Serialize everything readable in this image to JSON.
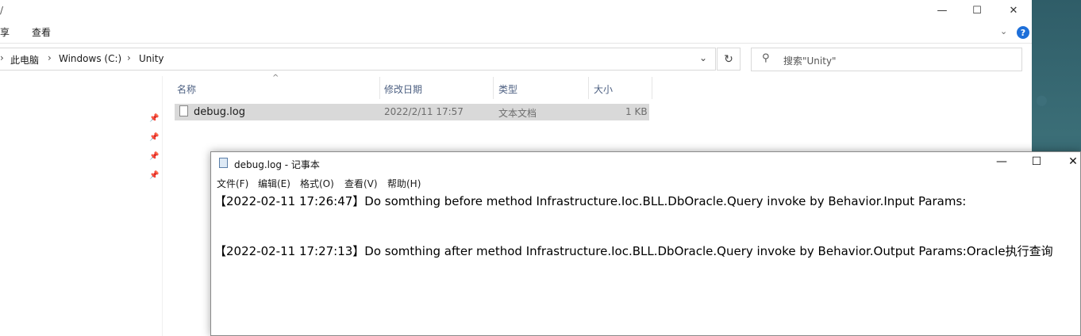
{
  "explorer": {
    "title_fragment": "/",
    "window_controls": {
      "minimize": "—",
      "maximize": "☐",
      "close": "✕"
    },
    "ribbon_tabs": [
      "享",
      "查看"
    ],
    "breadcrumb": [
      "此电脑",
      "Windows (C:)",
      "Unity"
    ],
    "search_placeholder": "搜索\"Unity\"",
    "columns": [
      "名称",
      "修改日期",
      "类型",
      "大小"
    ],
    "files": [
      {
        "name": "debug.log",
        "modified": "2022/2/11 17:57",
        "type": "文本文档",
        "size": "1 KB"
      }
    ]
  },
  "notepad": {
    "title": "debug.log - 记事本",
    "menu": [
      "文件(F)",
      "编辑(E)",
      "格式(O)",
      "查看(V)",
      "帮助(H)"
    ],
    "lines": [
      "【2022-02-11 17:26:47】Do somthing before method Infrastructure.Ioc.BLL.DbOracle.Query invoke by Behavior.Input Params:",
      "【2022-02-11 17:27:13】Do somthing after method Infrastructure.Ioc.BLL.DbOracle.Query invoke by Behavior.Output Params:Oracle执行查询"
    ]
  },
  "colors": {
    "selection": "#d9d9d9",
    "help_icon": "#1e6fd9",
    "header_text": "#4d6082"
  }
}
